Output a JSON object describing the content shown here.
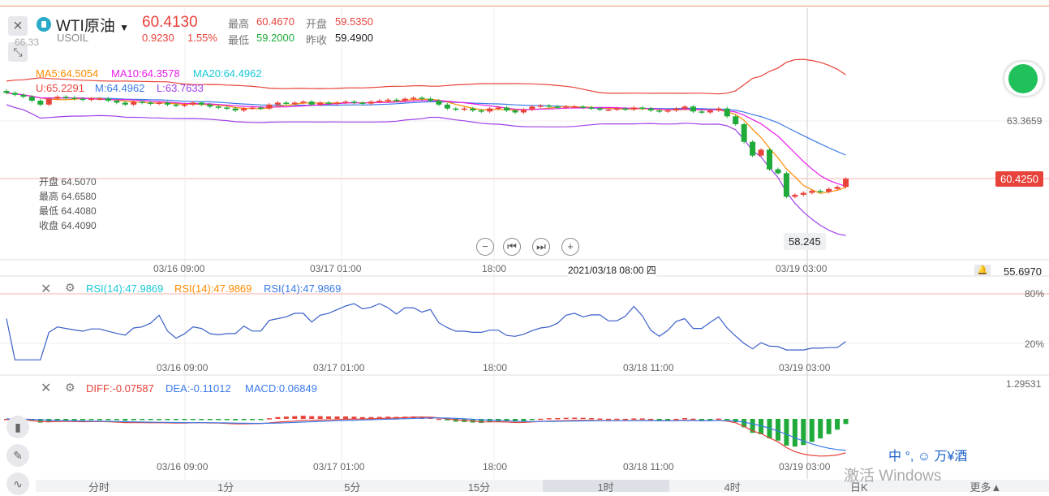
{
  "header": {
    "name": "WTI原油",
    "symbol": "USOIL",
    "price": "60.4130",
    "change": "0.9230",
    "change_pct": "1.55%",
    "high_label": "最高",
    "high": "60.4670",
    "open_label": "开盘",
    "open": "59.5350",
    "low_label": "最低",
    "low": "59.2000",
    "prev_label": "昨收",
    "prev": "59.4900"
  },
  "main": {
    "top_price": "66.33",
    "ma5": "MA5:64.5054",
    "ma10": "MA10:64.3578",
    "ma20": "MA20:64.4962",
    "boll_u": "U:65.2291",
    "boll_m": "M:64.4962",
    "boll_l": "L:63.7633",
    "ohlc": [
      "开盘 64.5070",
      "最高 64.6580",
      "最低 64.4080",
      "收盘 64.4090"
    ],
    "axis_right": [
      "63.3659",
      "55.6970"
    ],
    "current_tag": "60.4250",
    "cursor_value": "58.245",
    "x_labels": [
      "03/16 09:00",
      "03/17 01:00",
      "18:00",
      "2021/03/18 08:00 四",
      "03/19 03:00"
    ],
    "colors": {
      "up": "#e8433a",
      "down": "#1faa3a",
      "ma5": "#ff8a00",
      "ma10": "#e81ce8",
      "ma20": "#1aa0e8"
    }
  },
  "rsi": {
    "labels": [
      "RSI(14):47.9869",
      "RSI(14):47.9869",
      "RSI(14):47.9869"
    ],
    "levels": [
      "80%",
      "20%"
    ],
    "x_labels": [
      "03/16 09:00",
      "03/17 01:00",
      "18:00",
      "03/18 11:00",
      "03/19 03:00"
    ]
  },
  "macd": {
    "diff": "DIFF:-0.07587",
    "dea": "DEA:-0.11012",
    "macd": "MACD:0.06849",
    "top": "1.29531",
    "x_labels": [
      "03/16 09:00",
      "03/17 01:00",
      "18:00",
      "03/18 11:00",
      "03/19 03:00"
    ]
  },
  "tabs": [
    "分时",
    "1分",
    "5分",
    "15分",
    "1时",
    "4时",
    "日K",
    "更多▲"
  ],
  "active_tab": 4,
  "overlay": {
    "watermark": "激活 Windows",
    "ime": "中 °, ☺ 万¥酒"
  },
  "chart_data": {
    "type": "candlestick",
    "closes": [
      64.8,
      64.7,
      64.6,
      64.4,
      64.2,
      64.5,
      64.6,
      64.55,
      64.5,
      64.45,
      64.5,
      64.5,
      64.4,
      64.3,
      64.2,
      64.35,
      64.3,
      64.25,
      64.3,
      64.2,
      64.15,
      64.2,
      64.3,
      64.2,
      64.1,
      64.05,
      64.0,
      63.9,
      64.0,
      64.05,
      64.0,
      64.2,
      64.3,
      64.25,
      64.3,
      64.35,
      64.2,
      64.3,
      64.25,
      64.3,
      64.35,
      64.3,
      64.25,
      64.35,
      64.4,
      64.45,
      64.4,
      64.5,
      64.55,
      64.5,
      64.4,
      64.2,
      64.0,
      63.95,
      64.0,
      63.9,
      63.85,
      64.0,
      64.05,
      63.9,
      63.8,
      63.95,
      64.1,
      64.15,
      64.1,
      64.05,
      64.1,
      64.1,
      64.05,
      64.0,
      63.95,
      63.95,
      64.0,
      63.95,
      64.05,
      64.0,
      63.9,
      63.85,
      63.9,
      64.0,
      64.1,
      63.85,
      63.8,
      63.9,
      64.0,
      63.6,
      63.2,
      62.3,
      61.6,
      61.9,
      60.9,
      60.7,
      59.5,
      59.6,
      59.7,
      59.8,
      59.75,
      59.9,
      60.0,
      60.42
    ]
  }
}
